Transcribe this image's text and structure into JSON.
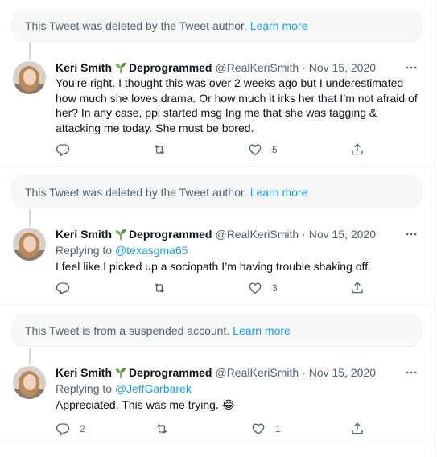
{
  "notices": [
    {
      "text": "This Tweet was deleted by the Tweet author.",
      "link": "Learn more"
    },
    {
      "text": "This Tweet was deleted by the Tweet author.",
      "link": "Learn more"
    },
    {
      "text": "This Tweet is from a suspended account.",
      "link": "Learn more"
    }
  ],
  "colors": {
    "accent": "#1d9bf0",
    "secondary_text": "#536471",
    "border": "#eff3f4",
    "notice_bg": "#f7f9f9"
  },
  "tweets": [
    {
      "name": "Keri Smith",
      "name_suffix": "Deprogrammed",
      "handle": "@RealKeriSmith",
      "date": "· Nov 15, 2020",
      "replying_prefix": "",
      "replying_to": "",
      "text": "You’re right. I thought this was over 2 weeks ago but I underestimated how much she loves drama. Or how much it irks her that I’m not afraid of her? In any case, ppl started msg Ing me that she was tagging & attacking me today. She must be bored.",
      "replies": "",
      "retweets": "",
      "likes": "5"
    },
    {
      "name": "Keri Smith",
      "name_suffix": "Deprogrammed",
      "handle": "@RealKeriSmith",
      "date": "· Nov 15, 2020",
      "replying_prefix": "Replying to",
      "replying_to": "@texasgma65",
      "text": "I feel like I picked up a sociopath I’m having trouble shaking off.",
      "replies": "",
      "retweets": "",
      "likes": "3"
    },
    {
      "name": "Keri Smith",
      "name_suffix": "Deprogrammed",
      "handle": "@RealKeriSmith",
      "date": "· Nov 15, 2020",
      "replying_prefix": "Replying to",
      "replying_to": "@JeffGarbarek",
      "text": "Appreciated. This was me trying. 😂",
      "replies": "2",
      "retweets": "",
      "likes": "1"
    }
  ],
  "icons": {
    "reply": "reply-icon",
    "retweet": "retweet-icon",
    "like": "heart-icon",
    "share": "share-icon",
    "more": "more-icon",
    "sprout": "sprout-emoji"
  }
}
